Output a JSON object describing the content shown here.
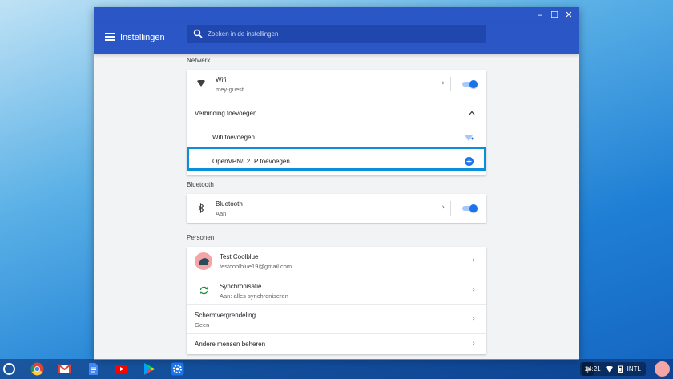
{
  "window": {
    "controls": {
      "minimize": "–",
      "maximize": "☐",
      "close": "✕"
    }
  },
  "header": {
    "title": "Instellingen",
    "search_placeholder": "Zoeken in de instellingen"
  },
  "sections": {
    "network": {
      "title": "Netwerk",
      "wifi": {
        "label": "Wifi",
        "sublabel": "mey-guest",
        "toggle_on": true
      },
      "add_connection": {
        "label": "Verbinding toevoegen"
      },
      "add_wifi": {
        "label": "Wifi toevoegen..."
      },
      "add_vpn": {
        "label": "OpenVPN/L2TP toevoegen..."
      }
    },
    "bluetooth": {
      "title": "Bluetooth",
      "bluetooth": {
        "label": "Bluetooth",
        "sublabel": "Aan",
        "toggle_on": true
      }
    },
    "people": {
      "title": "Personen",
      "account": {
        "name": "Test Coolblue",
        "email": "testcoolblue19@gmail.com"
      },
      "sync": {
        "label": "Synchronisatie",
        "sublabel": "Aan: alles synchroniseren"
      },
      "screen_lock": {
        "label": "Schermvergrendeling",
        "sublabel": "Geen"
      },
      "manage_people": {
        "label": "Andere mensen beheren"
      }
    }
  },
  "shelf": {
    "apps": [
      "chrome-icon",
      "gmail-icon",
      "docs-icon",
      "youtube-icon",
      "play-store-icon",
      "settings-icon"
    ],
    "tray": {
      "time": "14:21",
      "ime": "INTL"
    }
  },
  "colors": {
    "header_blue": "#2b57c6",
    "accent_blue": "#1a73e8",
    "highlight_border": "#0a8fd8"
  }
}
